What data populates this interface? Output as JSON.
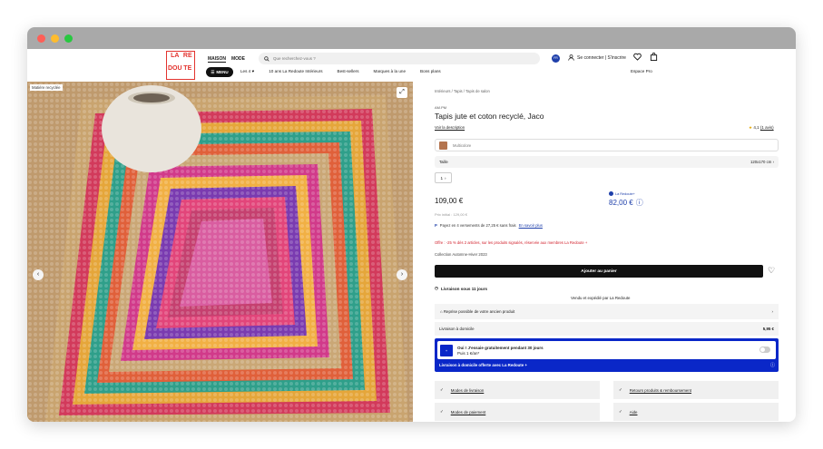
{
  "header": {
    "logo_lines": [
      "LA",
      "RE",
      "DOU",
      "TE"
    ],
    "nav": [
      "MAISON",
      "MODE"
    ],
    "search_placeholder": "Que recherchez-vous ?",
    "lang": "FR",
    "account": "Se connecter | S'inscrire"
  },
  "navbar": {
    "menu_label": "MENU",
    "items": [
      "Les 4 ♥",
      "10 ans La Redoute Intérieurs",
      "Best-sellers",
      "Marques à la une",
      "Bons plans"
    ],
    "right": "Espace Pro"
  },
  "gallery": {
    "badge": "Matière recyclée"
  },
  "product": {
    "breadcrumbs": "Intérieurs  /  Tapis  /  Tapis de salon",
    "brand": "AM.PM",
    "title": "Tapis jute et coton recyclé, Jaco",
    "desc_link": "Voir la description",
    "rating": "4,1",
    "rating_count": "(1 avis)",
    "color_placeholder": "Multicolore",
    "size_label": "Taille",
    "size_value": "120x170 cm",
    "qty": "1",
    "price": "109,00 €",
    "old_price": "Prix initial : 129,00 €",
    "redoute_tag": "La Redoute+",
    "redoute_price": "82,00 €",
    "paypal": "Payez en 4 versements de 27,25 € sans frais",
    "paypal_link": "En savoir plus",
    "offer": "Offre : -25 % dès 2 articles, sur les produits signalés, réservée aux membres La Redoute +",
    "collection": "Collection Automne-Hiver 2023",
    "add_to_cart": "Ajouter au panier",
    "delivery": "Livraison sous 11 jours",
    "sold_by": "Vendu et expédié par La Redoute",
    "reprise": "Reprise possible de votre ancien produit",
    "livraison_label": "Livraison à domicile",
    "livraison_price": "5,95 €",
    "promo_title": "Oui ! J'essaie gratuitement pendant 30 jours",
    "promo_sub": "Puis 1 €/an*",
    "promo_footer": "Livraison à domicile offerte avec La Redoute +",
    "links": [
      "Modes de livraison",
      "Retours produits & remboursement",
      "Modes de paiement",
      "Aide"
    ]
  },
  "colors": {
    "accent": "#0a27c8",
    "price_blue": "#1e3faa",
    "offer_red": "#d2222d"
  }
}
